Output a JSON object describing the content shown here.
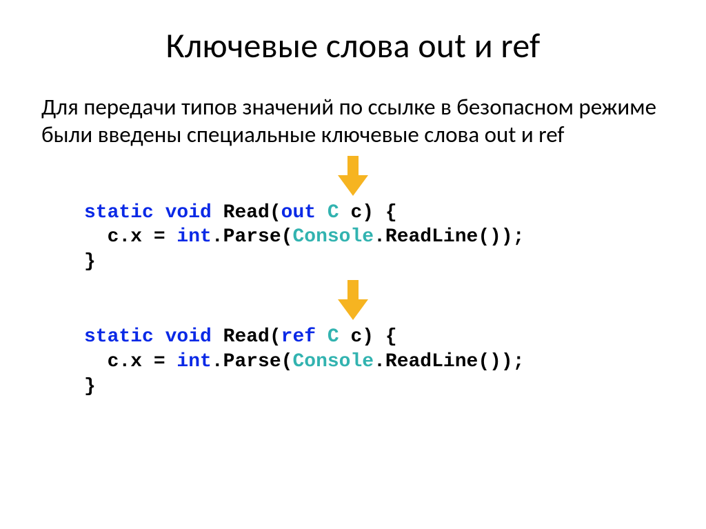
{
  "title": "Ключевые слова out и ref",
  "paragraph": "Для передачи типов значений по ссылке в безопасном режиме были введены специальные ключевые слова out и ref",
  "code1": {
    "l1a": "static ",
    "l1b": "void ",
    "l1c": "Read(",
    "l1d": "out ",
    "l1e": "C ",
    "l1f": "c) {",
    "l2a": "  c.x = ",
    "l2b": "int",
    "l2c": ".Parse(",
    "l2d": "Console",
    "l2e": ".ReadLine());",
    "l3": "}"
  },
  "code2": {
    "l1a": "static ",
    "l1b": "void ",
    "l1c": "Read(",
    "l1d": "ref ",
    "l1e": "C ",
    "l1f": "c) {",
    "l2a": "  c.x = ",
    "l2b": "int",
    "l2c": ".Parse(",
    "l2d": "Console",
    "l2e": ".ReadLine());",
    "l3": "}"
  },
  "colors": {
    "arrow": "#f6b421"
  }
}
